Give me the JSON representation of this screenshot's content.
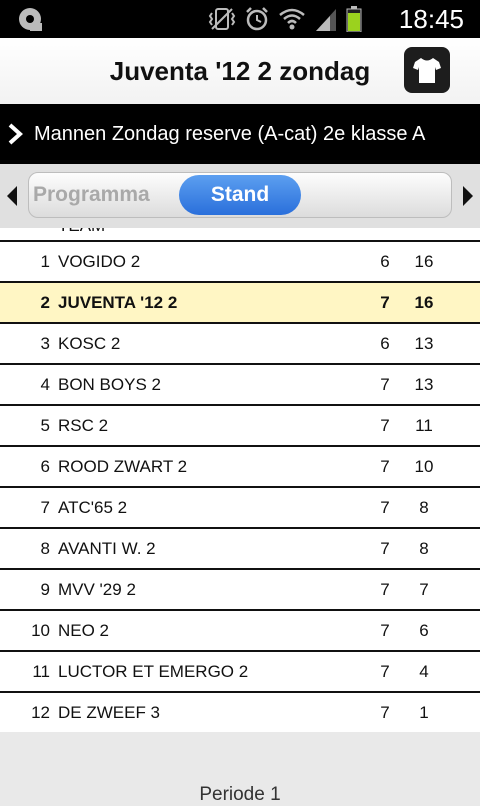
{
  "status_bar": {
    "time": "18:45",
    "icons": [
      "notification-icon",
      "vibrate-icon",
      "alarm-icon",
      "wifi-icon",
      "signal-icon",
      "battery-icon"
    ]
  },
  "header": {
    "title": "Juventa '12 2 zondag",
    "shirt_icon": "shirt-icon"
  },
  "competition": {
    "label": "Mannen Zondag reserve (A-cat) 2e klasse A"
  },
  "tabs": {
    "programma": "Programma",
    "stand": "Stand"
  },
  "partial_header": {
    "team": "TEAM"
  },
  "standings": [
    {
      "pos": "1",
      "team": "VOGIDO 2",
      "played": "6",
      "points": "16"
    },
    {
      "pos": "2",
      "team": "JUVENTA '12 2",
      "played": "7",
      "points": "16",
      "highlight": true
    },
    {
      "pos": "3",
      "team": "KOSC 2",
      "played": "6",
      "points": "13"
    },
    {
      "pos": "4",
      "team": "BON BOYS 2",
      "played": "7",
      "points": "13"
    },
    {
      "pos": "5",
      "team": "RSC 2",
      "played": "7",
      "points": "11"
    },
    {
      "pos": "6",
      "team": "ROOD ZWART 2",
      "played": "7",
      "points": "10"
    },
    {
      "pos": "7",
      "team": "ATC'65 2",
      "played": "7",
      "points": "8"
    },
    {
      "pos": "8",
      "team": "AVANTI W. 2",
      "played": "7",
      "points": "8"
    },
    {
      "pos": "9",
      "team": "MVV '29 2",
      "played": "7",
      "points": "7"
    },
    {
      "pos": "10",
      "team": "NEO 2",
      "played": "7",
      "points": "6"
    },
    {
      "pos": "11",
      "team": "LUCTOR ET EMERGO 2",
      "played": "7",
      "points": "4"
    },
    {
      "pos": "12",
      "team": "DE ZWEEF 3",
      "played": "7",
      "points": "1"
    }
  ],
  "footer": {
    "periode": "Periode 1"
  },
  "colors": {
    "highlight_row": "#fff6c4",
    "active_tab": "#2a6fdb"
  }
}
